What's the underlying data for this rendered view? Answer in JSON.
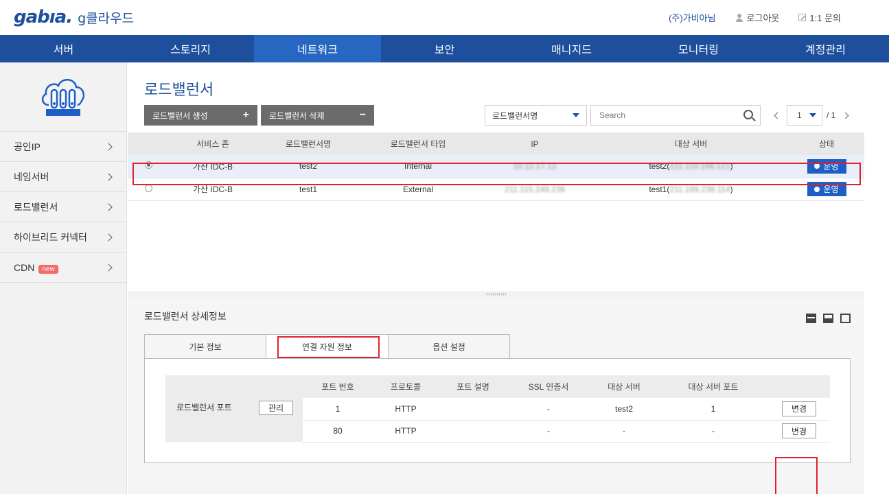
{
  "header": {
    "logo": "gabıa.",
    "logo_sub": "g클라우드",
    "company": "(주)가비아님",
    "logout": "로그아웃",
    "inquiry": "1:1 문의"
  },
  "nav": [
    "서버",
    "스토리지",
    "네트워크",
    "보안",
    "매니지드",
    "모니터링",
    "계정관리"
  ],
  "nav_active": "네트워크",
  "sidebar": {
    "items": [
      {
        "label": "공인IP"
      },
      {
        "label": "네임서버"
      },
      {
        "label": "로드밸런서"
      },
      {
        "label": "하이브리드 커넥터"
      },
      {
        "label": "CDN",
        "badge": "new"
      }
    ]
  },
  "page": {
    "title": "로드밸런서",
    "create_btn": "로드밸런서 생성",
    "delete_btn": "로드밸런서 삭제",
    "filter_select": "로드밸런서명",
    "search_placeholder": "Search",
    "page_current": "1",
    "page_total": "/ 1"
  },
  "table": {
    "headers": [
      "",
      "서비스 존",
      "로드밸런서명",
      "로드밸런서 타입",
      "IP",
      "대상 서버",
      "상태"
    ],
    "rows": [
      {
        "zone": "가산 IDC-B",
        "name": "test2",
        "type": "Internal",
        "ip": "10.12.17.12",
        "target": "test2(",
        "target_ip": "211.110.166.121",
        "target_end": ")",
        "status": "운영",
        "selected": true
      },
      {
        "zone": "가산 IDC-B",
        "name": "test1",
        "type": "External",
        "ip": "211.115.249.236",
        "target": "test1(",
        "target_ip": "211.169.238.114",
        "target_end": ")",
        "status": "운영",
        "selected": false
      }
    ]
  },
  "detail": {
    "title": "로드밸런서 상세정보",
    "tabs": [
      "기본 정보",
      "연결 자원 정보",
      "옵션 설정"
    ],
    "active_tab": "연결 자원 정보",
    "port_label": "로드밸런서 포트",
    "manage_btn": "관리",
    "port_headers": [
      "포트 번호",
      "프로토콜",
      "포트 설명",
      "SSL 인증서",
      "대상 서버",
      "대상 서버 포트",
      ""
    ],
    "ports": [
      {
        "port": "1",
        "protocol": "HTTP",
        "desc": "",
        "ssl": "-",
        "target": "test2",
        "target_port": "1",
        "action": "변경"
      },
      {
        "port": "80",
        "protocol": "HTTP",
        "desc": "",
        "ssl": "-",
        "target": "-",
        "target_port": "-",
        "action": "변경"
      }
    ]
  },
  "colors": {
    "brand": "#1d4f9c",
    "nav_active": "#2767c2",
    "status": "#1d5fc4",
    "highlight": "#e0212b"
  }
}
